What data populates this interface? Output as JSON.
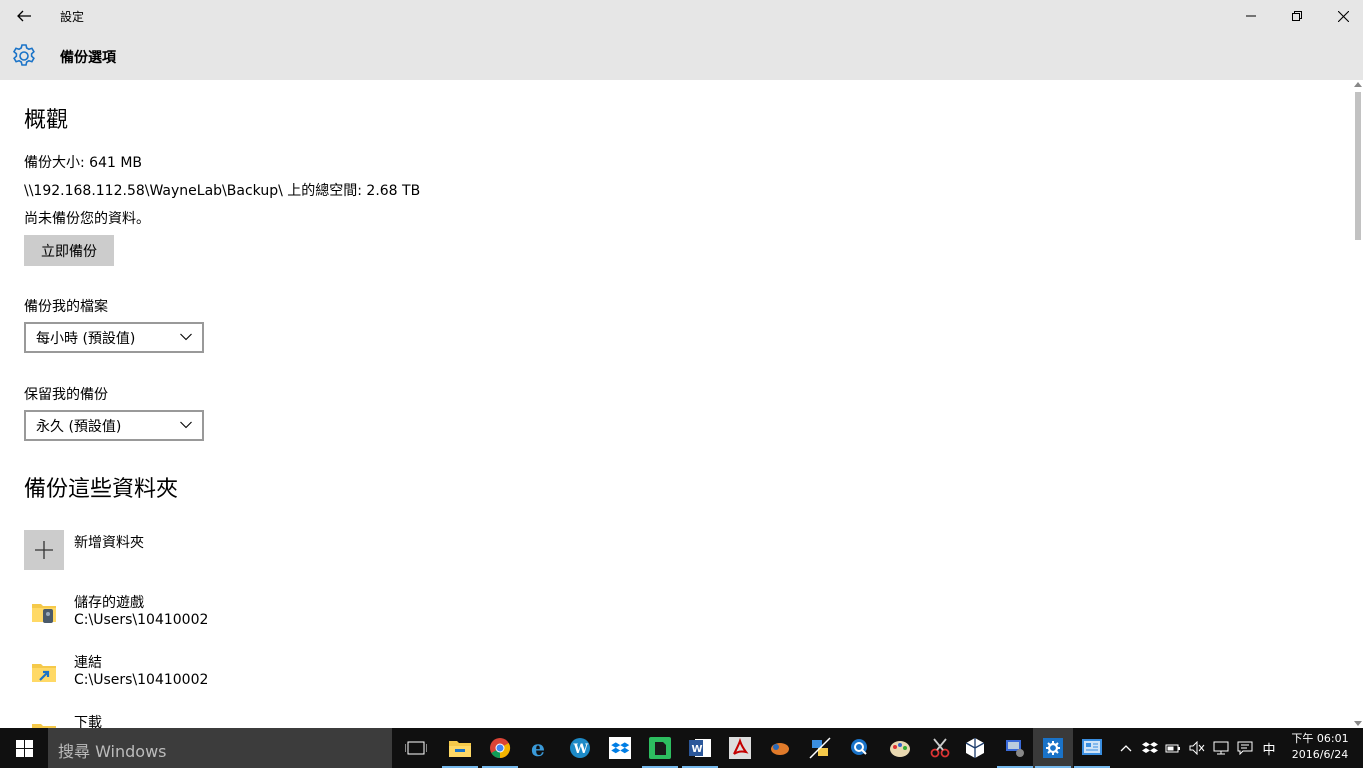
{
  "window": {
    "title": "設定"
  },
  "header": {
    "page_title": "備份選項"
  },
  "overview": {
    "heading": "概觀",
    "backup_size": "備份大小: 641 MB",
    "total_space": "\\\\192.168.112.58\\WayneLab\\Backup\\ 上的總空間: 2.68 TB",
    "status": "尚未備份您的資料。",
    "backup_now_label": "立即備份"
  },
  "backup_frequency": {
    "label": "備份我的檔案",
    "selected": "每小時 (預設值)"
  },
  "keep_backups": {
    "label": "保留我的備份",
    "selected": "永久 (預設值)"
  },
  "folders": {
    "heading": "備份這些資料夾",
    "add_label": "新增資料夾",
    "items": [
      {
        "name": "儲存的遊戲",
        "path": "C:\\Users\\10410002"
      },
      {
        "name": "連結",
        "path": "C:\\Users\\10410002"
      },
      {
        "name": "下載",
        "path": ""
      }
    ]
  },
  "taskbar": {
    "search_placeholder": "搜尋 Windows",
    "clock_time": "下午 06:01",
    "clock_date": "2016/6/24",
    "ime": "中",
    "accent": "#76b9ed"
  }
}
